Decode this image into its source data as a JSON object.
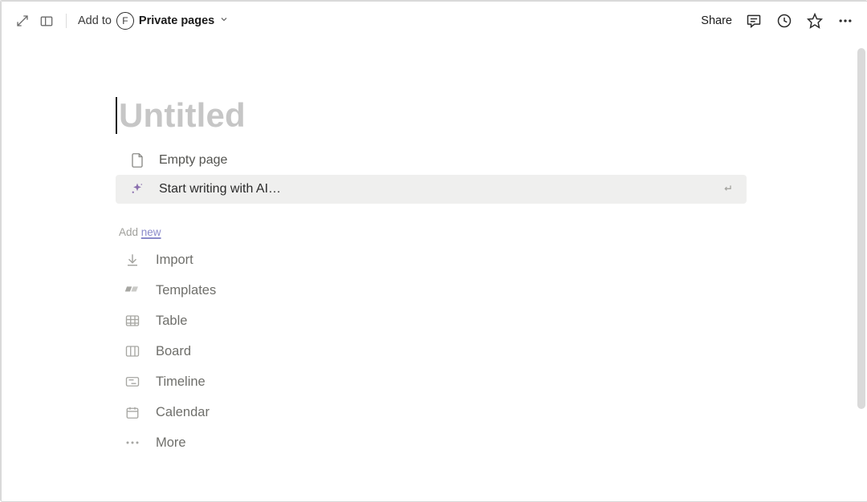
{
  "topbar": {
    "add_to_label": "Add to",
    "avatar_letter": "F",
    "location_label": "Private pages",
    "share_label": "Share"
  },
  "title": {
    "placeholder": "Untitled"
  },
  "primary_options": {
    "empty_page": "Empty page",
    "ai_write": "Start writing with AI…"
  },
  "section": {
    "add_label": "Add ",
    "new_label": "new"
  },
  "new_items": {
    "import": "Import",
    "templates": "Templates",
    "table": "Table",
    "board": "Board",
    "timeline": "Timeline",
    "calendar": "Calendar",
    "more": "More"
  }
}
